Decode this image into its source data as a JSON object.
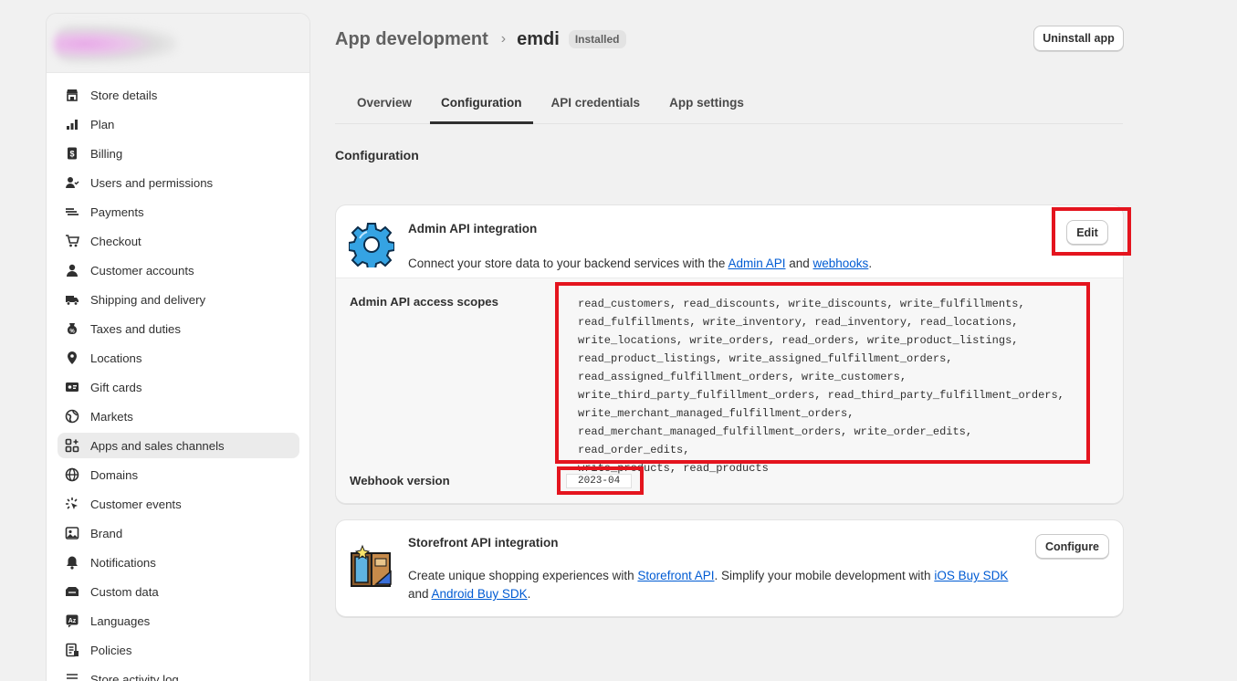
{
  "sidebar": {
    "items": [
      {
        "label": "Store details",
        "icon": "store-icon"
      },
      {
        "label": "Plan",
        "icon": "plan-icon"
      },
      {
        "label": "Billing",
        "icon": "billing-icon"
      },
      {
        "label": "Users and permissions",
        "icon": "users-icon"
      },
      {
        "label": "Payments",
        "icon": "payments-icon"
      },
      {
        "label": "Checkout",
        "icon": "cart-icon"
      },
      {
        "label": "Customer accounts",
        "icon": "person-icon"
      },
      {
        "label": "Shipping and delivery",
        "icon": "truck-icon"
      },
      {
        "label": "Taxes and duties",
        "icon": "tax-icon"
      },
      {
        "label": "Locations",
        "icon": "location-icon"
      },
      {
        "label": "Gift cards",
        "icon": "gift-card-icon"
      },
      {
        "label": "Markets",
        "icon": "globe-icon"
      },
      {
        "label": "Apps and sales channels",
        "icon": "apps-icon"
      },
      {
        "label": "Domains",
        "icon": "domains-icon"
      },
      {
        "label": "Customer events",
        "icon": "events-icon"
      },
      {
        "label": "Brand",
        "icon": "brand-icon"
      },
      {
        "label": "Notifications",
        "icon": "bell-icon"
      },
      {
        "label": "Custom data",
        "icon": "data-icon"
      },
      {
        "label": "Languages",
        "icon": "language-icon"
      },
      {
        "label": "Policies",
        "icon": "policies-icon"
      },
      {
        "label": "Store activity log",
        "icon": "activity-log-icon"
      }
    ]
  },
  "header": {
    "parent": "App development",
    "title": "emdi",
    "badge": "Installed",
    "uninstall_label": "Uninstall app"
  },
  "tabs": [
    {
      "label": "Overview"
    },
    {
      "label": "Configuration"
    },
    {
      "label": "API credentials"
    },
    {
      "label": "App settings"
    }
  ],
  "section_title": "Configuration",
  "admin_card": {
    "title": "Admin API integration",
    "desc_prefix": "Connect your store data to your backend services with the ",
    "link1": "Admin API",
    "desc_mid": " and ",
    "link2": "webhooks",
    "desc_suffix": ".",
    "edit_label": "Edit",
    "scopes_label": "Admin API access scopes",
    "scopes_lines": [
      "read_customers, read_discounts, write_discounts, write_fulfillments,",
      "read_fulfillments, write_inventory, read_inventory, read_locations,",
      "write_locations, write_orders, read_orders, write_product_listings,",
      "read_product_listings, write_assigned_fulfillment_orders,",
      "read_assigned_fulfillment_orders, write_customers,",
      "write_third_party_fulfillment_orders, read_third_party_fulfillment_orders,",
      "write_merchant_managed_fulfillment_orders,",
      "read_merchant_managed_fulfillment_orders, write_order_edits, read_order_edits,",
      "write_products, read_products"
    ],
    "webhook_label": "Webhook version",
    "webhook_value": "2023-04"
  },
  "storefront_card": {
    "title": "Storefront API integration",
    "desc_prefix": "Create unique shopping experiences with ",
    "link1": "Storefront API",
    "desc_mid": ". Simplify your mobile development with ",
    "link2": "iOS Buy SDK",
    "desc_and": " and ",
    "link3": "Android Buy SDK",
    "desc_suffix": ".",
    "configure_label": "Configure"
  },
  "colors": {
    "accent_link": "#005bd3",
    "highlight_box": "#e4141e",
    "gear_blue": "#35a3e3"
  }
}
